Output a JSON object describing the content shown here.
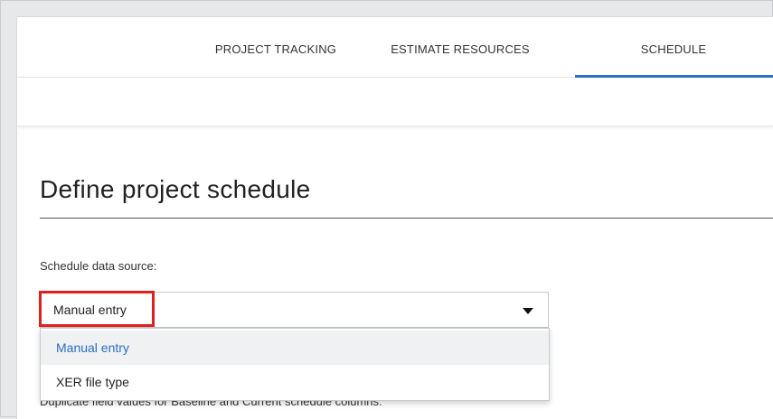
{
  "tabs": {
    "project_tracking": "PROJECT TRACKING",
    "estimate_resources": "ESTIMATE RESOURCES",
    "schedule": "SCHEDULE",
    "active": "schedule"
  },
  "main": {
    "title": "Define project schedule",
    "source_label": "Schedule data source:",
    "select": {
      "value": "Manual entry",
      "options": [
        "Manual entry",
        "XER file type"
      ],
      "highlighted_option": "Manual entry"
    },
    "hint": "Duplicate field values for Baseline and Current schedule columns:"
  },
  "colors": {
    "accent": "#2a6fc0",
    "highlight_border": "#e02020"
  }
}
